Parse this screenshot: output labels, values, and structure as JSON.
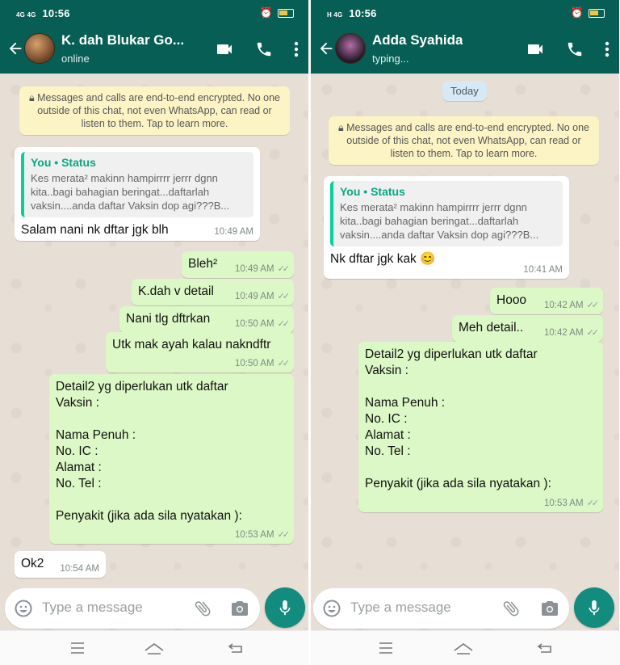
{
  "status_bar": {
    "a": {
      "network": "4G 4G",
      "time": "10:56"
    },
    "b": {
      "network": "H 4G",
      "time": "10:56"
    }
  },
  "chat_a": {
    "contact_name": "K. dah Blukar Go...",
    "contact_status": "online",
    "encryption_notice": "Messages and calls are end-to-end encrypted. No one outside of this chat, not even WhatsApp, can read or listen to them. Tap to learn more.",
    "quoted": {
      "author": "You • Status",
      "text": "Kes merata² makinn hampirrrr jerrr dgnn kita..bagi bahagian beringat...daftarlah vaksin....anda daftar Vaksin dop agi???B..."
    },
    "messages": [
      {
        "text": "Salam nani nk dftar jgk blh",
        "time": "10:49 AM",
        "direction": "in"
      },
      {
        "text": "Bleh²",
        "time": "10:49 AM",
        "direction": "out"
      },
      {
        "text": "K.dah v detail",
        "time": "10:49 AM",
        "direction": "out"
      },
      {
        "text": "Nani tlg dftrkan",
        "time": "10:50 AM",
        "direction": "out"
      },
      {
        "text": "Utk mak ayah kalau nakndftr",
        "time": "10:50 AM",
        "direction": "out"
      },
      {
        "text": "Detail2 yg diperlukan utk daftar\nVaksin :\n\nNama Penuh  :\nNo. IC     :\nAlamat   :\nNo. Tel :\n\nPenyakit (jika ada sila nyatakan ):",
        "time": "10:53 AM",
        "direction": "out"
      },
      {
        "text": "Ok2",
        "time": "10:54 AM",
        "direction": "in"
      }
    ],
    "input_placeholder": "Type a message"
  },
  "chat_b": {
    "contact_name": "Adda Syahida",
    "contact_status": "typing...",
    "day_chip": "Today",
    "encryption_notice": "Messages and calls are end-to-end encrypted. No one outside of this chat, not even WhatsApp, can read or listen to them. Tap to learn more.",
    "quoted": {
      "author": "You • Status",
      "text": "Kes merata² makinn hampirrrr jerrr dgnn kita..bagi bahagian beringat...daftarlah vaksin....anda daftar Vaksin dop agi???B..."
    },
    "messages": [
      {
        "text": "Nk dftar jgk kak",
        "time": "10:41 AM",
        "direction": "in"
      },
      {
        "text": "Hooo",
        "time": "10:42 AM",
        "direction": "out"
      },
      {
        "text": "Meh detail..",
        "time": "10:42 AM",
        "direction": "out"
      },
      {
        "text": "Detail2 yg diperlukan utk daftar\nVaksin :\n\nNama Penuh  :\nNo. IC     :\nAlamat   :\nNo. Tel :\n\nPenyakit (jika ada sila nyatakan ):",
        "time": "10:53 AM",
        "direction": "out"
      }
    ],
    "input_placeholder": "Type a message"
  },
  "colors": {
    "header": "#075e54",
    "outgoing_bubble": "#dcf8c6",
    "incoming_bubble": "#ffffff",
    "mic_button": "#128c7e",
    "quote_accent": "#06cf9c"
  }
}
